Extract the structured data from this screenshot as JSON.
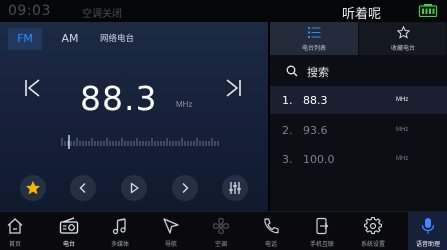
{
  "status_bar": {
    "time": "09:03",
    "ac_status": "空调关闭",
    "app_title": "听着呢",
    "battery_icon": "battery-full-icon",
    "battery_color": "#3cd43c"
  },
  "radio": {
    "tabs": [
      {
        "label": "FM",
        "active": true
      },
      {
        "label": "AM",
        "active": false
      },
      {
        "label": "网络电台",
        "active": false
      }
    ],
    "frequency": "88.3",
    "unit": "MHz",
    "controls": [
      "favorite-star-icon",
      "prev-arrow-icon",
      "play-icon",
      "next-arrow-icon",
      "equalizer-icon"
    ],
    "accent_color": "#2f8cff",
    "star_color": "#f5b800"
  },
  "list_panel": {
    "tabs": [
      {
        "label": "电台列表",
        "icon": "list-icon",
        "active": true
      },
      {
        "label": "收藏电台",
        "icon": "star-outline-icon",
        "active": false
      }
    ],
    "search_label": "搜索",
    "stations": [
      {
        "num": "1.",
        "freq": "88.3",
        "unit": "MHz",
        "active": true
      },
      {
        "num": "2.",
        "freq": "93.6",
        "unit": "MHz",
        "active": false
      },
      {
        "num": "3.",
        "freq": "100.0",
        "unit": "MHz",
        "active": false
      }
    ]
  },
  "nav": {
    "items": [
      {
        "label": "首页",
        "icon": "home-icon"
      },
      {
        "label": "电台",
        "icon": "radio-icon"
      },
      {
        "label": "多媒体",
        "icon": "music-note-icon"
      },
      {
        "label": "导航",
        "icon": "navigation-arrow-icon"
      },
      {
        "label": "空调",
        "icon": "fan-icon"
      },
      {
        "label": "电话",
        "icon": "phone-icon"
      },
      {
        "label": "手机互联",
        "icon": "phone-link-icon"
      },
      {
        "label": "系统设置",
        "icon": "gear-icon"
      },
      {
        "label": "语音助理",
        "icon": "microphone-icon"
      }
    ]
  }
}
